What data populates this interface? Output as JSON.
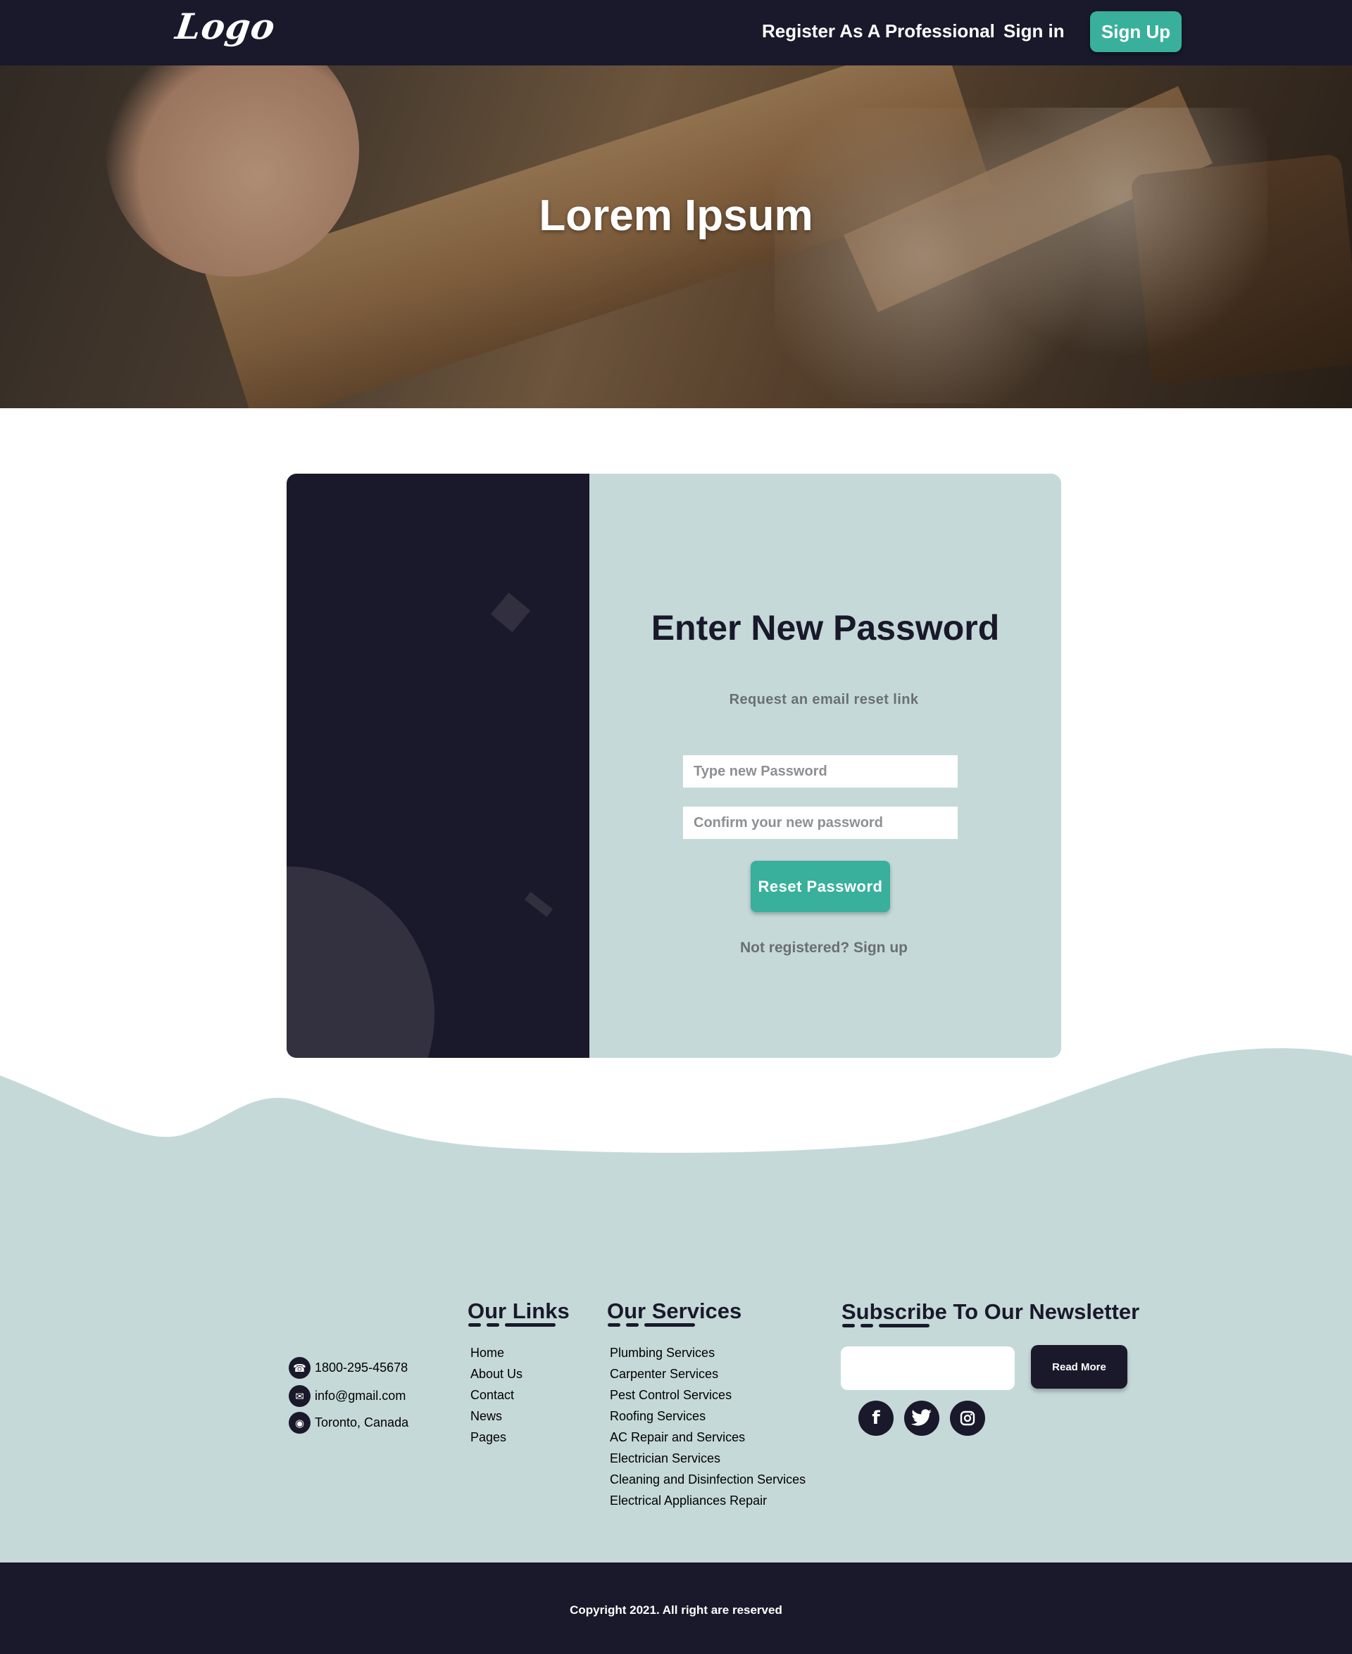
{
  "header": {
    "logo": "Logo",
    "nav": {
      "register": "Register As A Professional",
      "signin": "Sign in",
      "signup": "Sign Up"
    }
  },
  "hero": {
    "title": "Lorem Ipsum"
  },
  "reset_card": {
    "title": "Enter New Password",
    "subtitle": "Request an email reset link",
    "new_password_placeholder": "Type new Password",
    "confirm_password_placeholder": "Confirm your new password",
    "reset_button": "Reset Password",
    "signup_prompt": "Not registered? Sign up"
  },
  "footer": {
    "contact": {
      "phone": "1800-295-45678",
      "email": "info@gmail.com",
      "location": "Toronto, Canada"
    },
    "links_heading": "Our Links",
    "links": [
      "Home",
      "About Us",
      "Contact",
      "News",
      "Pages"
    ],
    "services_heading": "Our Services",
    "services": [
      "Plumbing Services",
      "Carpenter Services",
      "Pest Control Services",
      "Roofing Services",
      "AC Repair and Services",
      "Electrician Services",
      "Cleaning and Disinfection Services",
      "Electrical Appliances Repair"
    ],
    "newsletter_heading": "Subscribe To Our Newsletter",
    "newsletter_input_value": "",
    "read_more": "Read More",
    "social_icons": [
      "facebook-icon",
      "twitter-icon",
      "instagram-icon"
    ],
    "copyright": "Copyright 2021. All right are reserved"
  },
  "colors": {
    "dark_navy": "#19192b",
    "accent_teal": "#39b09b",
    "light_teal_bg": "#c5d9d8",
    "muted_text": "#6a6f72"
  }
}
